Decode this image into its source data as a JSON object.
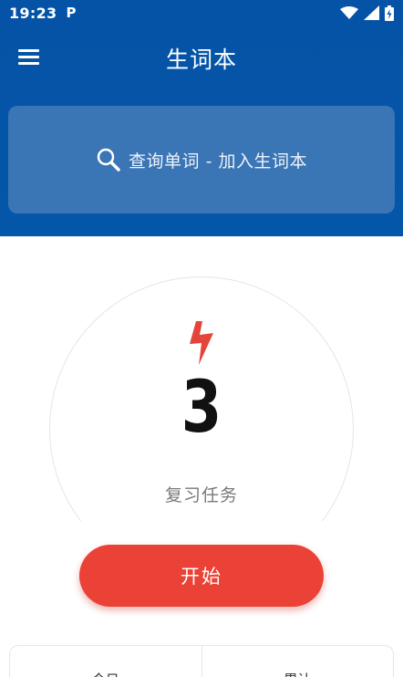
{
  "status_bar": {
    "time": "19:23",
    "notification_icon": "P",
    "icons": [
      "wifi-icon",
      "signal-icon",
      "battery-icon"
    ]
  },
  "header": {
    "title": "生词本",
    "menu_icon": "hamburger-menu-icon",
    "search": {
      "icon": "search-icon",
      "text": "查询单词 - 加入生词本"
    }
  },
  "review": {
    "icon": "lightning-icon",
    "count": "3",
    "label": "复习任务"
  },
  "start_button": {
    "label": "开始"
  },
  "bottom_tabs": [
    {
      "label": "今日"
    },
    {
      "label": "累计"
    }
  ],
  "colors": {
    "primary_blue": "#0553a6",
    "search_bg": "#3a75b5",
    "accent_red": "#ea4236"
  }
}
